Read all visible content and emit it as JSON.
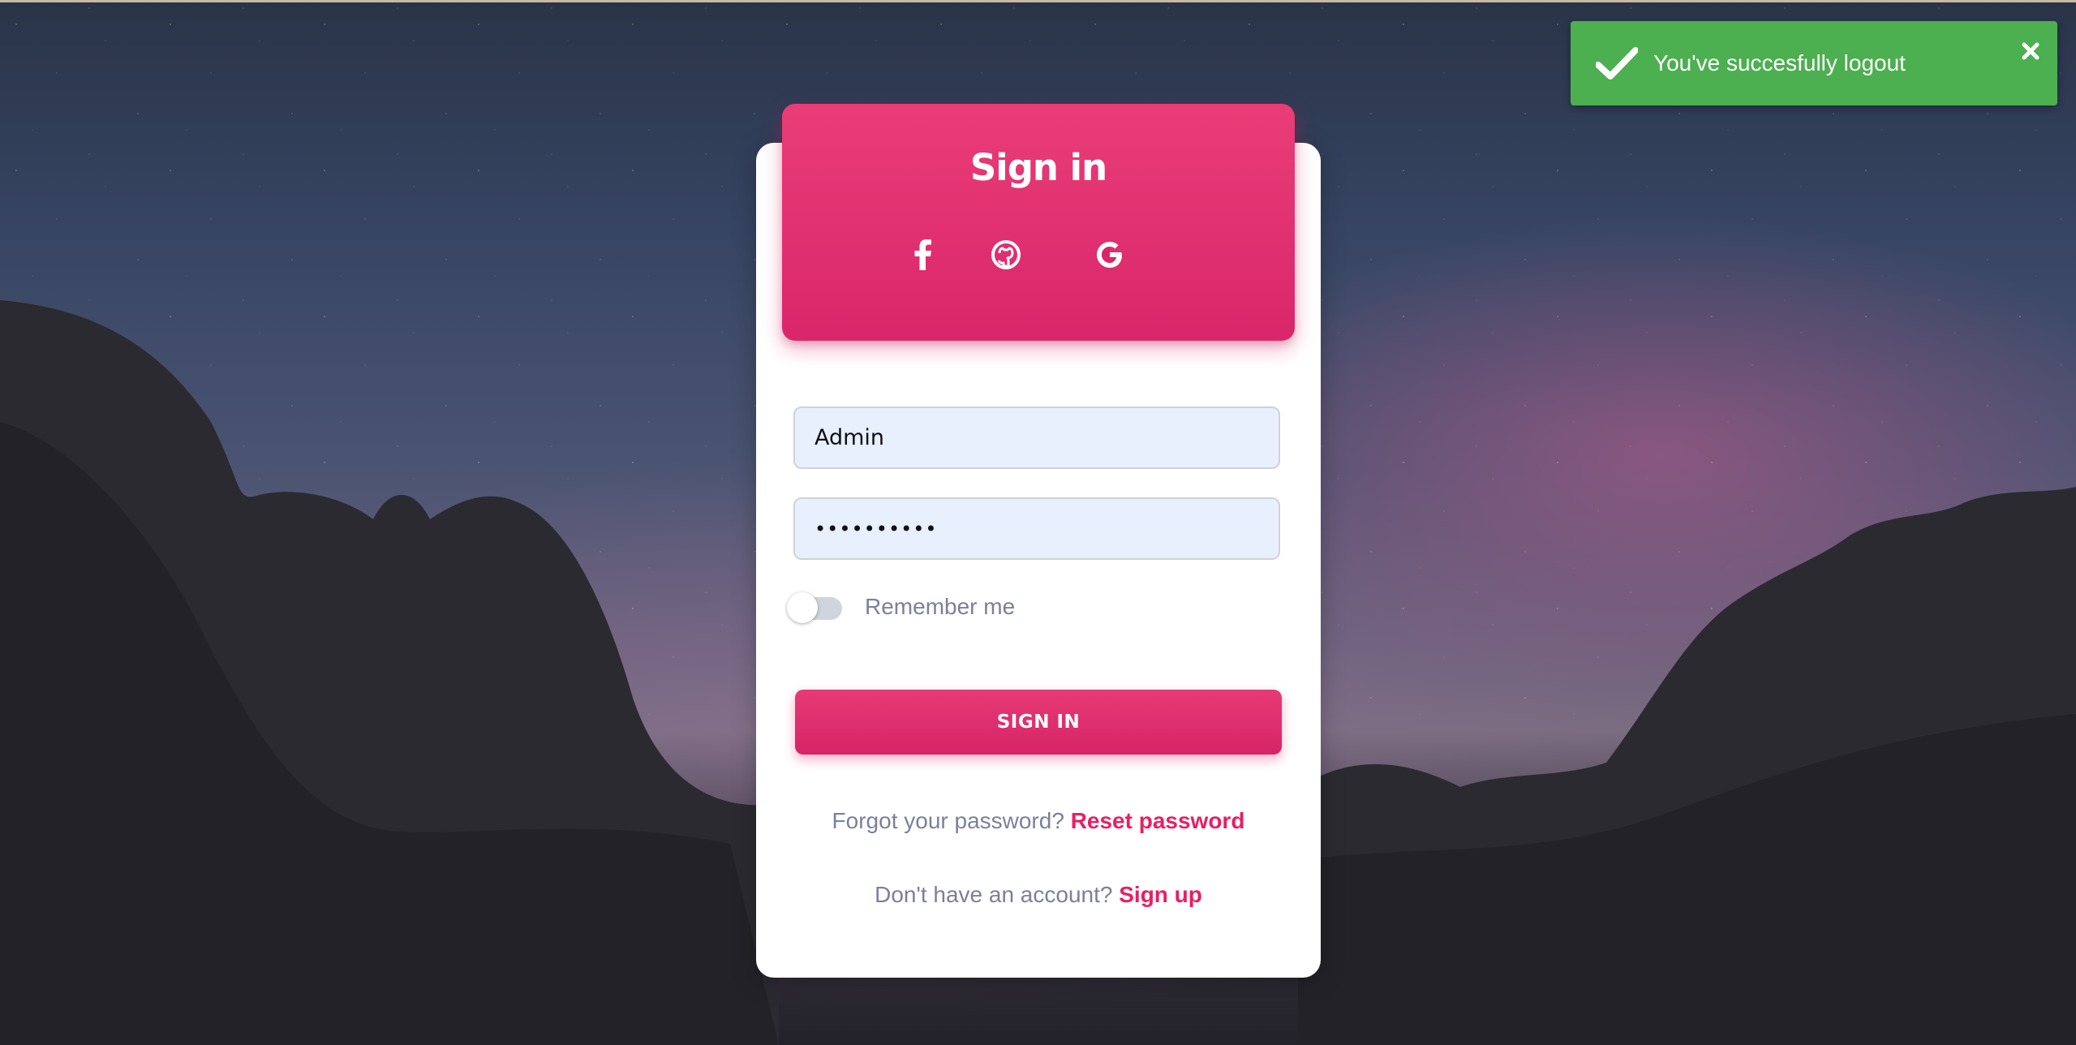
{
  "signin": {
    "title": "Sign in",
    "social_buttons": [
      {
        "icon": "facebook-icon"
      },
      {
        "icon": "github-icon"
      },
      {
        "icon": "google-icon"
      }
    ],
    "username_value": "Admin",
    "password_value": "••••••••••",
    "remember_label": "Remember me",
    "remember_checked": false,
    "submit_label": "SIGN IN",
    "forgot_text": "Forgot your password?",
    "reset_link": "Reset password",
    "no_account_text": "Don't have an account?",
    "signup_link": "Sign up"
  },
  "toast": {
    "message": "You've succesfully logout",
    "icon": "checkmark-icon",
    "close_icon": "close-icon"
  },
  "colors": {
    "primary": "#e91e63",
    "toast_success": "#4caf50",
    "input_bg": "#e8f0fe",
    "muted_text": "#7b809a"
  }
}
